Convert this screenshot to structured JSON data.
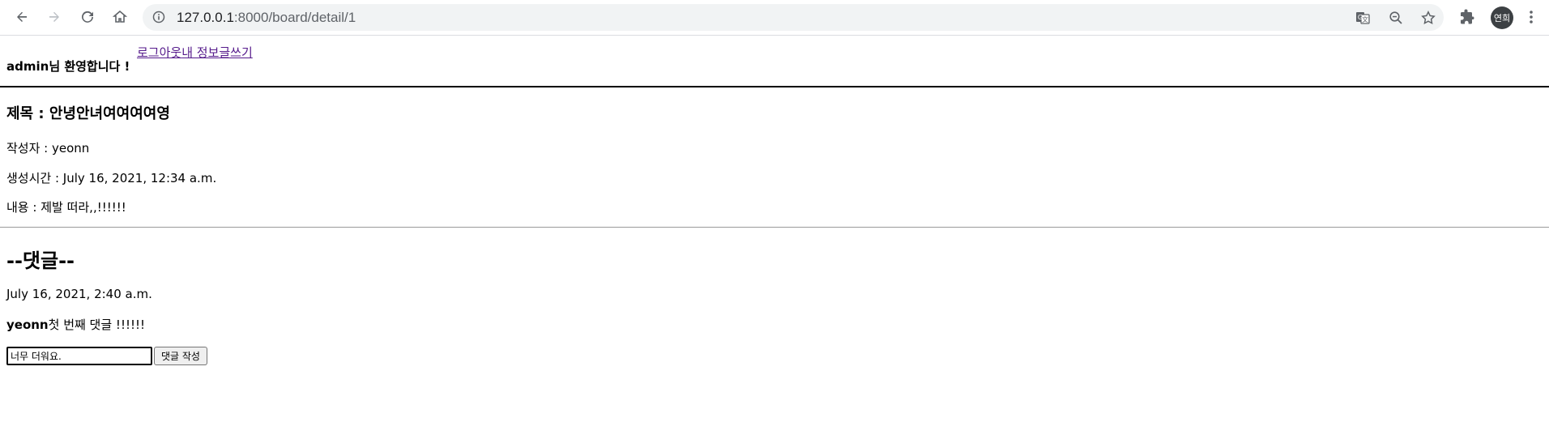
{
  "browser": {
    "url_host": "127.0.0.1",
    "url_rest": ":8000/board/detail/1",
    "profile_initials": "연희",
    "icons": {
      "back": "back-arrow-icon",
      "forward": "forward-arrow-icon",
      "reload": "reload-icon",
      "home": "home-icon",
      "site_info": "info-icon",
      "translate": "translate-icon",
      "zoom": "zoom-out-icon",
      "bookmark": "star-icon",
      "extensions": "puzzle-icon",
      "menu": "kebab-menu-icon"
    }
  },
  "header": {
    "welcome_user": "admin",
    "welcome_suffix": "님 환영합니다 !",
    "logout_link": "로그아웃",
    "profile_link": "내 정보",
    "write_link": "글쓰기"
  },
  "post": {
    "title_label": "제목 : ",
    "title": "안녕안녀여여여여영",
    "author_label": "작성자 : ",
    "author": "yeonn",
    "created_label": "생성시간 : ",
    "created": "July 16, 2021, 12:34 a.m.",
    "content_label": "내용 : ",
    "content": "제발 떠라,,!!!!!!"
  },
  "comments": {
    "heading": "--댓글--",
    "items": [
      {
        "date": "July 16, 2021, 2:40 a.m.",
        "author": "yeonn",
        "text": "첫 번째 댓글 !!!!!!"
      }
    ],
    "input_value": "너무 더워요.",
    "submit_label": "댓글 작성"
  }
}
